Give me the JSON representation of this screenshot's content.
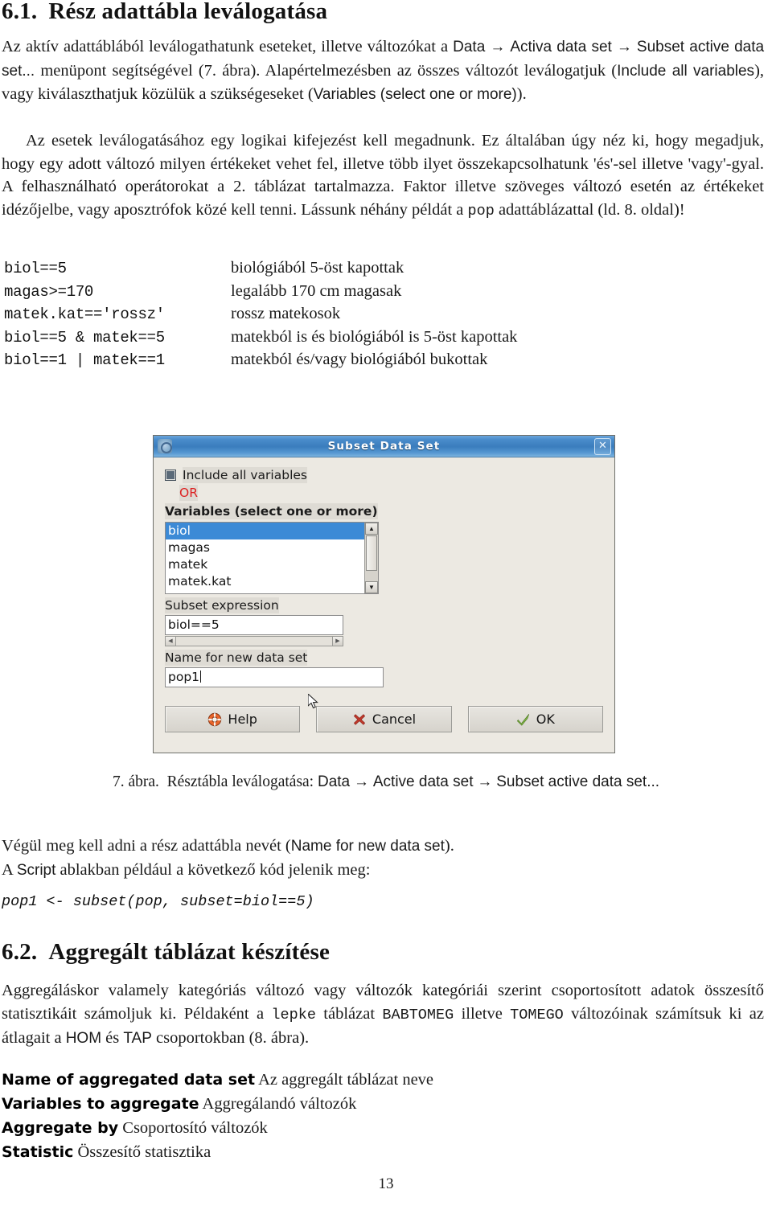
{
  "document": {
    "page_number": "13"
  },
  "section_61": {
    "number": "6.1.",
    "title": "Rész adattábla leválogatása",
    "paragraph_1_a": "Az aktív adattáblából leválogathatunk eseteket, illetve változókat a ",
    "menu_data": "Data",
    "arrow": "→",
    "menu_active": "Activa data set",
    "menu_subset": "Subset active data set...",
    "paragraph_1_b": " menüpont segítségével (7. ábra). Alapértelmezésben az összes változót leválogatjuk (",
    "include_all": "Include all variables",
    "paragraph_1_c": "), vagy kiválaszthatjuk közülük a szükségeseket (",
    "variables_label": "Variables (select one or more)",
    "paragraph_1_d": ").",
    "paragraph_2": "Az esetek leválogatásához egy logikai kifejezést kell megadnunk. Ez általában úgy néz ki, hogy megadjuk, hogy egy adott változó milyen értékeket vehet fel, illetve több ilyet összekapcsolhatunk 'és'-sel illetve 'vagy'-gyal. A felhasználható operátorokat a 2. táblázat tartalmazza. Faktor illetve szöveges változó esetén az értékeket idézőjelbe, vagy aposztrófok közé kell tenni. Lássunk néhány példát a ",
    "pop_code": "pop",
    "paragraph_2_b": " adattáblázattal (ld. 8. oldal)!"
  },
  "examples": [
    {
      "code": "biol==5",
      "desc": "biológiából 5-öst kapottak"
    },
    {
      "code": "magas>=170",
      "desc": "legalább 170 cm magasak"
    },
    {
      "code": "matek.kat=='rossz'",
      "desc": "rossz matekosok"
    },
    {
      "code": "biol==5 & matek==5",
      "desc": "matekból is és biológiából is 5-öst kapottak"
    },
    {
      "code": "biol==1 | matek==1",
      "desc": "matekból és/vagy biológiából bukottak"
    }
  ],
  "dialog": {
    "title": "Subset Data Set",
    "close_label": "✕",
    "include_all_checkbox": "Include all variables",
    "or_label": "OR",
    "variables_header": "Variables (select one or more)",
    "variables": [
      "biol",
      "magas",
      "matek",
      "matek.kat"
    ],
    "selected_variable": "biol",
    "subset_expression_label": "Subset expression",
    "subset_expression_value": "biol==5",
    "name_label": "Name for new data set",
    "name_value": "pop1",
    "buttons": {
      "help": "Help",
      "cancel": "Cancel",
      "ok": "OK"
    },
    "colors": {
      "titlebar_blue": "#3a7dbd",
      "selection_blue": "#3c8ad6",
      "or_red": "#dd2222",
      "dialog_bg": "#ece9e2",
      "cancel_icon": "#c0392b",
      "ok_icon": "#7cb342",
      "help_icon": "#e8642a"
    }
  },
  "figure_caption": {
    "number": "7. ábra.",
    "text": "Résztábla leválogatása: ",
    "menu_1": "Data",
    "arrow": "→",
    "menu_2": "Active data set",
    "menu_3": "Subset active data set..."
  },
  "after_figure": {
    "line_1_a": "Végül meg kell adni a rész adattábla nevét (",
    "line_1_name": "Name for new data set",
    "line_1_b": ").",
    "line_2_a": "A ",
    "line_2_script": "Script",
    "line_2_b": " ablakban például a következő kód jelenik meg:",
    "code": "pop1 <- subset(pop, subset=biol==5)"
  },
  "section_62": {
    "number": "6.2.",
    "title": "Aggregált táblázat készítése",
    "paragraph_a": "Aggregáláskor valamely kategóriás változó vagy változók kategóriái szerint csoportosított adatok összesítő statisztikáit számoljuk ki. Példaként a ",
    "code_lepke": "lepke",
    "paragraph_b": " táblázat ",
    "code_babtomeg": "BABTOMEG",
    "paragraph_c": " illetve ",
    "code_tomeg": "TOMEGO",
    "paragraph_d": " változóinak számítsuk ki az átlagait a ",
    "code_hom": "HOM",
    "paragraph_e": " és ",
    "code_tap": "TAP",
    "paragraph_f": " csoportokban (8. ábra)."
  },
  "definitions": [
    {
      "term": "Name of aggregated data set",
      "desc": "Az aggregált táblázat neve"
    },
    {
      "term": "Variables to aggregate",
      "desc": "Aggregálandó változók"
    },
    {
      "term": "Aggregate by",
      "desc": "Csoportosító változók"
    },
    {
      "term": "Statistic",
      "desc": "Összesítő statisztika"
    }
  ]
}
